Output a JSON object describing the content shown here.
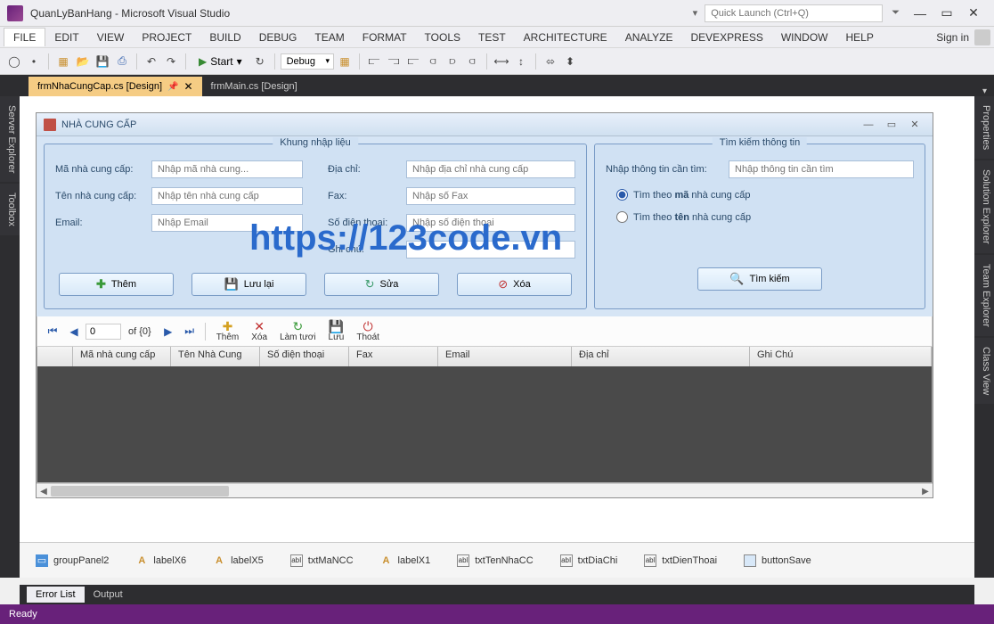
{
  "title": "QuanLyBanHang - Microsoft Visual Studio",
  "quick_launch_placeholder": "Quick Launch (Ctrl+Q)",
  "signin": "Sign in",
  "menu": [
    "FILE",
    "EDIT",
    "VIEW",
    "PROJECT",
    "BUILD",
    "DEBUG",
    "TEAM",
    "FORMAT",
    "TOOLS",
    "TEST",
    "ARCHITECTURE",
    "ANALYZE",
    "DEVEXPRESS",
    "WINDOW",
    "HELP"
  ],
  "toolbar": {
    "start": "Start",
    "config": "Debug"
  },
  "tabs": {
    "active": "frmNhaCungCap.cs [Design]",
    "other": "frmMain.cs [Design]"
  },
  "rails": {
    "left": [
      "Server Explorer",
      "Toolbox"
    ],
    "right": [
      "Properties",
      "Solution Explorer",
      "Team Explorer",
      "Class View"
    ]
  },
  "form": {
    "title": "NHÀ CUNG CẤP",
    "group_input_legend": "Khung nhập liệu",
    "group_search_legend": "Tìm kiếm thông tin",
    "labels": {
      "ma": "Mã nhà cung cấp:",
      "ten": "Tên nhà cung cấp:",
      "email": "Email:",
      "diachi": "Địa chỉ:",
      "fax": "Fax:",
      "sdt": "Số điện thoại:",
      "ghichu": "Ghi chú:",
      "search_lbl": "Nhập thông tin cần tìm:"
    },
    "placeholders": {
      "ma": "Nhập mã nhà cung...",
      "ten": "Nhập tên nhà cung cấp",
      "email": "Nhập Email",
      "diachi": "Nhập địa chỉ nhà cung cấp",
      "fax": "Nhập số Fax",
      "sdt": "Nhập số điện thoại",
      "search": "Nhập thông tin cần tìm"
    },
    "radios": {
      "r1": "Tìm theo mã nhà cung cấp",
      "r2": "Tìm theo tên nhà cung cấp"
    },
    "buttons": {
      "add": "Thêm",
      "save": "Lưu lại",
      "edit": "Sửa",
      "del": "Xóa",
      "search": "Tìm kiếm"
    }
  },
  "nav": {
    "pos": "0",
    "of": "of {0}",
    "add": "Thêm",
    "del": "Xóa",
    "refresh": "Làm tươi",
    "save": "Lưu",
    "exit": "Thoát"
  },
  "grid_cols": [
    "",
    "Mã nhà cung cấp",
    "Tên Nhà Cung",
    "Số điện thoại",
    "Fax",
    "Email",
    "Địa chỉ",
    "Ghi Chú"
  ],
  "tray": [
    "groupPanel2",
    "labelX6",
    "labelX5",
    "txtMaNCC",
    "labelX1",
    "txtTenNhaCC",
    "txtDiaChi",
    "txtDienThoai",
    "buttonSave"
  ],
  "bottom_tabs": {
    "active": "Error List",
    "other": "Output"
  },
  "status": "Ready",
  "watermark": "https://123code.vn"
}
